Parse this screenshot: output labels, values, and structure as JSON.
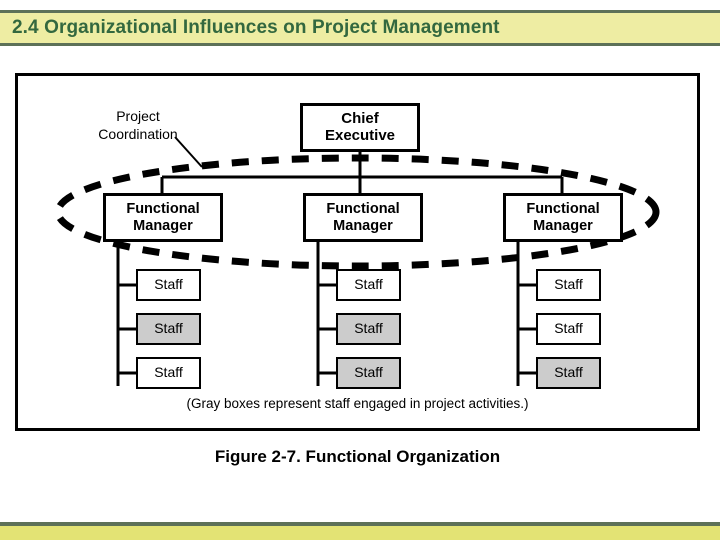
{
  "header": {
    "title": "2.4 Organizational Influences on Project Management",
    "band_color": "#eeeda3",
    "text_color": "#33683f",
    "rule_color": "#5d7158"
  },
  "footer": {
    "rule_color": "#5d7158",
    "band_color": "#e3e374"
  },
  "diagram": {
    "annotation_label": "Project\nCoordination",
    "annotation_line1": "Project",
    "annotation_line2": "Coordination",
    "executive": {
      "line1": "Chief",
      "line2": "Executive"
    },
    "managers": [
      {
        "line1": "Functional",
        "line2": "Manager"
      },
      {
        "line1": "Functional",
        "line2": "Manager"
      },
      {
        "line1": "Functional",
        "line2": "Manager"
      }
    ],
    "staff_columns": [
      [
        {
          "label": "Staff",
          "shaded": false
        },
        {
          "label": "Staff",
          "shaded": true
        },
        {
          "label": "Staff",
          "shaded": false
        }
      ],
      [
        {
          "label": "Staff",
          "shaded": false
        },
        {
          "label": "Staff",
          "shaded": true
        },
        {
          "label": "Staff",
          "shaded": true
        }
      ],
      [
        {
          "label": "Staff",
          "shaded": false
        },
        {
          "label": "Staff",
          "shaded": false
        },
        {
          "label": "Staff",
          "shaded": true
        }
      ]
    ],
    "legend_note": "(Gray boxes represent staff engaged in project activities.)",
    "figure_caption": "Figure 2-7. Functional Organization",
    "shaded_fill": "#cccccc",
    "box_fill": "#ffffff",
    "stroke_color": "#000000"
  }
}
